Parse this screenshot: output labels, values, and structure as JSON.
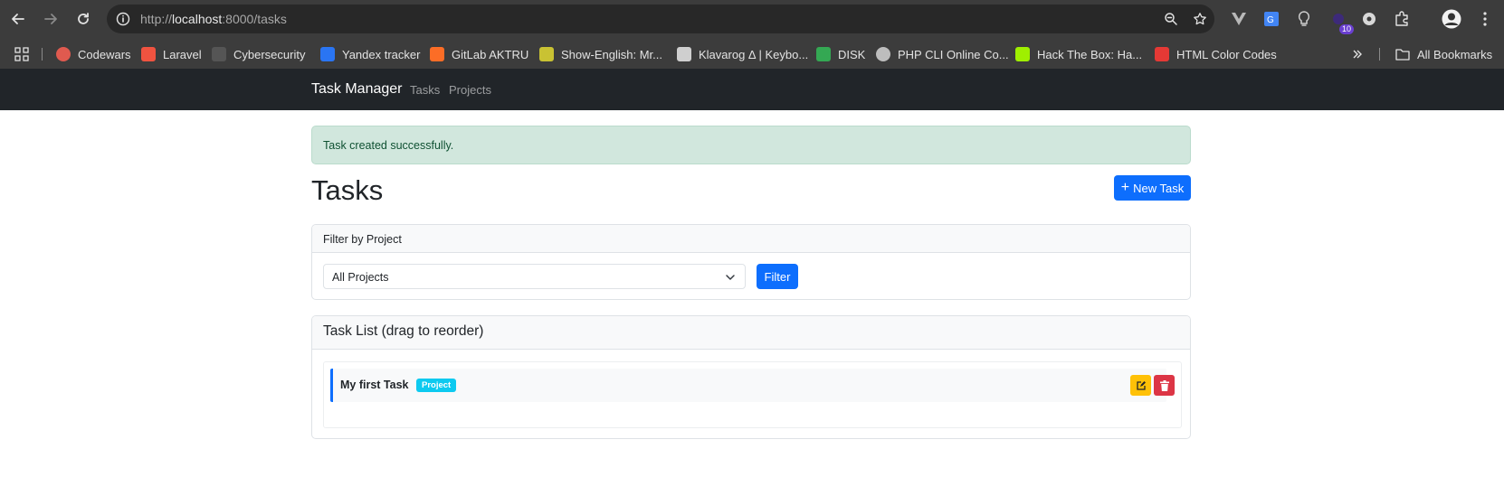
{
  "browser": {
    "url_scheme": "http://",
    "url_host": "localhost",
    "url_rest": ":8000/tasks",
    "extension_badge": "10",
    "bookmarks": [
      {
        "label": "Codewars",
        "icon": "codewars-icon",
        "color": "#e05a4f"
      },
      {
        "label": "Laravel",
        "icon": "laravel-icon",
        "color": "#f05340"
      },
      {
        "label": "Cybersecurity",
        "icon": "cybersecurity-icon",
        "color": "#555555"
      },
      {
        "label": "Yandex tracker",
        "icon": "yandex-tracker-icon",
        "color": "#2a75f3"
      },
      {
        "label": "GitLab AKTRU",
        "icon": "gitlab-icon",
        "color": "#fc6d26"
      },
      {
        "label": "Show-English: Mr...",
        "icon": "tv-icon",
        "color": "#c9c233"
      },
      {
        "label": "Klavarog Δ | Keybo...",
        "icon": "keyboard-icon",
        "color": "#cfcfcf"
      },
      {
        "label": "DISK",
        "icon": "google-drive-icon",
        "color": "#34a853"
      },
      {
        "label": "PHP CLI Online Co...",
        "icon": "globe-icon",
        "color": "#bdbdbd"
      },
      {
        "label": "Hack The Box: Ha...",
        "icon": "hackthebox-icon",
        "color": "#9fef00"
      },
      {
        "label": "HTML Color Codes",
        "icon": "html-color-codes-icon",
        "color": "#e53935"
      }
    ],
    "all_bookmarks": "All Bookmarks"
  },
  "navbar": {
    "brand": "Task Manager",
    "links": [
      "Tasks",
      "Projects"
    ]
  },
  "alert": {
    "message": "Task created successfully."
  },
  "page": {
    "title": "Tasks",
    "new_task_button": "New Task",
    "new_task_icon": "+"
  },
  "filter": {
    "header": "Filter by Project",
    "selected": "All Projects",
    "button": "Filter"
  },
  "task_list": {
    "header": "Task List (drag to reorder)",
    "tasks": [
      {
        "title": "My first Task",
        "project": "Project"
      }
    ]
  },
  "colors": {
    "primary": "#0d6efd",
    "warning": "#ffc107",
    "danger": "#dc3545",
    "info": "#0dcaf0",
    "success_bg": "#d1e7dd",
    "success_text": "#0f5132"
  }
}
